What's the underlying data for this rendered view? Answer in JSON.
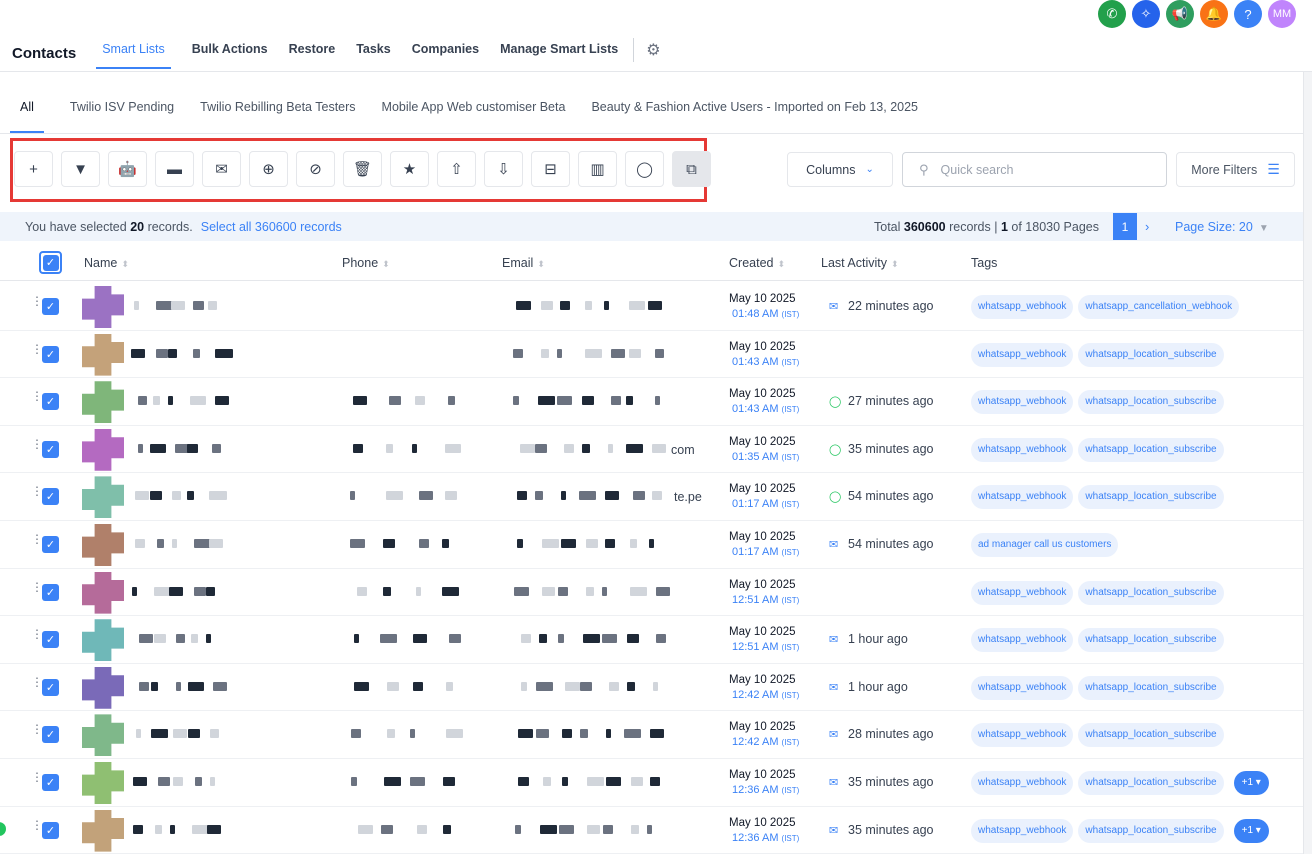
{
  "header": {
    "top_icons": [
      {
        "name": "phone-icon",
        "glyph": "✆",
        "color": "#22a04b",
        "dot": false
      },
      {
        "name": "sparkle-icon",
        "glyph": "✧",
        "color": "#2563eb",
        "dot": false
      },
      {
        "name": "megaphone-icon",
        "glyph": "📢",
        "color": "#2f9e5f",
        "dot": true
      },
      {
        "name": "bell-icon",
        "glyph": "🔔",
        "color": "#f97316",
        "dot": true
      },
      {
        "name": "help-icon",
        "glyph": "?",
        "color": "#3b82f6",
        "dot": false
      },
      {
        "name": "avatar",
        "glyph": "MM",
        "color": "#c084fc",
        "dot": false
      }
    ],
    "title": "Contacts",
    "nav": [
      "Smart Lists",
      "Bulk Actions",
      "Restore",
      "Tasks",
      "Companies",
      "Manage Smart Lists"
    ]
  },
  "subtabs": [
    "All",
    "Twilio ISV Pending",
    "Twilio Rebilling Beta Testers",
    "Mobile App Web customiser Beta",
    "Beauty & Fashion Active Users - Imported on Feb 13, 2025"
  ],
  "toolbar": [
    {
      "name": "add-icon",
      "glyph": "+"
    },
    {
      "name": "filter-icon",
      "glyph": "▼"
    },
    {
      "name": "bot-icon",
      "glyph": "🤖"
    },
    {
      "name": "message-icon",
      "glyph": "▬"
    },
    {
      "name": "email-icon",
      "glyph": "✉"
    },
    {
      "name": "add-tag-icon",
      "glyph": "⊕"
    },
    {
      "name": "remove-tag-icon",
      "glyph": "⊘"
    },
    {
      "name": "delete-icon",
      "glyph": "🗑"
    },
    {
      "name": "star-icon",
      "glyph": "★"
    },
    {
      "name": "export-icon",
      "glyph": "⇧"
    },
    {
      "name": "import-icon",
      "glyph": "⇩"
    },
    {
      "name": "bag-icon",
      "glyph": "⊟"
    },
    {
      "name": "company-icon",
      "glyph": "▥"
    },
    {
      "name": "whatsapp-icon",
      "glyph": "◯"
    },
    {
      "name": "merge-icon",
      "glyph": "⧉"
    }
  ],
  "controls": {
    "columns_label": "Columns",
    "search_placeholder": "Quick search",
    "more_filters_label": "More Filters"
  },
  "selection": {
    "prefix": "You have selected ",
    "count": "20",
    "suffix": " records.",
    "select_all": "Select all 360600 records",
    "total_prefix": "Total ",
    "total": "360600",
    "total_mid": " records | ",
    "page": "1",
    "page_of": " of 18030 Pages",
    "current_page": "1",
    "page_size": "Page Size: 20"
  },
  "columns": [
    "Name",
    "Phone",
    "Email",
    "Created",
    "Last Activity",
    "Tags"
  ],
  "rows": [
    {
      "avatar": "#9b72c3",
      "date": "May 10 2025",
      "time": "01:48 AM",
      "tz": "(IST)",
      "activity": "22 minutes ago",
      "activity_icon": "mail",
      "tags": [
        "whatsapp_webhook",
        "whatsapp_cancellation_webhook"
      ],
      "more": "",
      "email_tail": ""
    },
    {
      "avatar": "#c4a27a",
      "date": "May 10 2025",
      "time": "01:43 AM",
      "tz": "(IST)",
      "activity": "",
      "activity_icon": "",
      "tags": [
        "whatsapp_webhook",
        "whatsapp_location_subscribe"
      ],
      "more": "",
      "email_tail": ""
    },
    {
      "avatar": "#7fb67a",
      "date": "May 10 2025",
      "time": "01:43 AM",
      "tz": "(IST)",
      "activity": "27 minutes ago",
      "activity_icon": "wa",
      "tags": [
        "whatsapp_webhook",
        "whatsapp_location_subscribe"
      ],
      "more": "",
      "email_tail": ""
    },
    {
      "avatar": "#b46ac1",
      "date": "May 10 2025",
      "time": "01:35 AM",
      "tz": "(IST)",
      "activity": "35 minutes ago",
      "activity_icon": "wa",
      "tags": [
        "whatsapp_webhook",
        "whatsapp_location_subscribe"
      ],
      "more": "",
      "email_tail": "com"
    },
    {
      "avatar": "#7fbfaa",
      "date": "May 10 2025",
      "time": "01:17 AM",
      "tz": "(IST)",
      "activity": "54 minutes ago",
      "activity_icon": "wa",
      "tags": [
        "whatsapp_webhook",
        "whatsapp_location_subscribe"
      ],
      "more": "",
      "email_tail": "te.pe"
    },
    {
      "avatar": "#b0806a",
      "date": "May 10 2025",
      "time": "01:17 AM",
      "tz": "(IST)",
      "activity": "54 minutes ago",
      "activity_icon": "mail",
      "tags": [
        "ad manager call us customers"
      ],
      "more": "",
      "email_tail": ""
    },
    {
      "avatar": "#b56b9a",
      "date": "May 10 2025",
      "time": "12:51 AM",
      "tz": "(IST)",
      "activity": "",
      "activity_icon": "",
      "tags": [
        "whatsapp_webhook",
        "whatsapp_location_subscribe"
      ],
      "more": "",
      "email_tail": ""
    },
    {
      "avatar": "#6fb8b8",
      "date": "May 10 2025",
      "time": "12:51 AM",
      "tz": "(IST)",
      "activity": "1 hour ago",
      "activity_icon": "mail",
      "tags": [
        "whatsapp_webhook",
        "whatsapp_location_subscribe"
      ],
      "more": "",
      "email_tail": ""
    },
    {
      "avatar": "#7a6ab8",
      "date": "May 10 2025",
      "time": "12:42 AM",
      "tz": "(IST)",
      "activity": "1 hour ago",
      "activity_icon": "mail",
      "tags": [
        "whatsapp_webhook",
        "whatsapp_location_subscribe"
      ],
      "more": "",
      "email_tail": ""
    },
    {
      "avatar": "#7fb88a",
      "date": "May 10 2025",
      "time": "12:42 AM",
      "tz": "(IST)",
      "activity": "28 minutes ago",
      "activity_icon": "mail",
      "tags": [
        "whatsapp_webhook",
        "whatsapp_location_subscribe"
      ],
      "more": "",
      "email_tail": ""
    },
    {
      "avatar": "#8fbf72",
      "date": "May 10 2025",
      "time": "12:36 AM",
      "tz": "(IST)",
      "activity": "35 minutes ago",
      "activity_icon": "mail",
      "tags": [
        "whatsapp_webhook",
        "whatsapp_location_subscribe"
      ],
      "more": "+1",
      "email_tail": ""
    },
    {
      "avatar": "#c2a27a",
      "date": "May 10 2025",
      "time": "12:36 AM",
      "tz": "(IST)",
      "activity": "35 minutes ago",
      "activity_icon": "mail",
      "tags": [
        "whatsapp_webhook",
        "whatsapp_location_subscribe"
      ],
      "more": "+1",
      "email_tail": ""
    }
  ]
}
